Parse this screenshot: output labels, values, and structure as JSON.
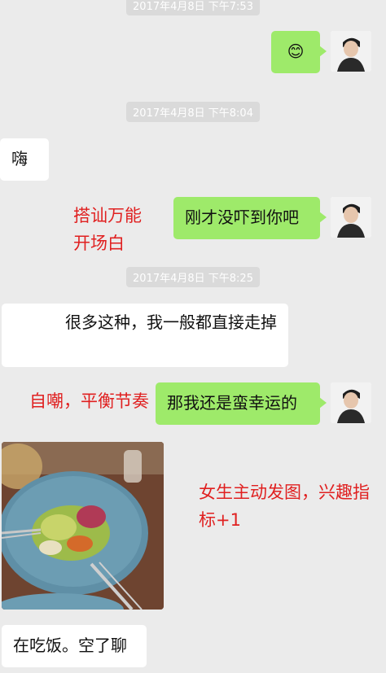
{
  "timestamps": {
    "t1": "2017年4月8日 下午7:53",
    "t2": "2017年4月8日 下午8:04",
    "t3": "2017年4月8日 下午8:25"
  },
  "messages": {
    "m1_emoji": "😊",
    "m2": "嗨",
    "m3": "刚才没吓到你吧",
    "m4": "很多这种，我一般都直接走掉",
    "m5": "那我还是蛮幸运的",
    "m7": "在吃饭。空了聊"
  },
  "annotations": {
    "a1_line1": "搭讪万能",
    "a1_line2": "开场白",
    "a2": "自嘲，平衡节奏",
    "a3_line1": "女生主动发图，兴趣指",
    "a3_line2": "标+1"
  },
  "colors": {
    "background": "#ebebeb",
    "bubble_right": "#9eea6a",
    "bubble_left": "#ffffff",
    "annotation": "#e02020"
  }
}
